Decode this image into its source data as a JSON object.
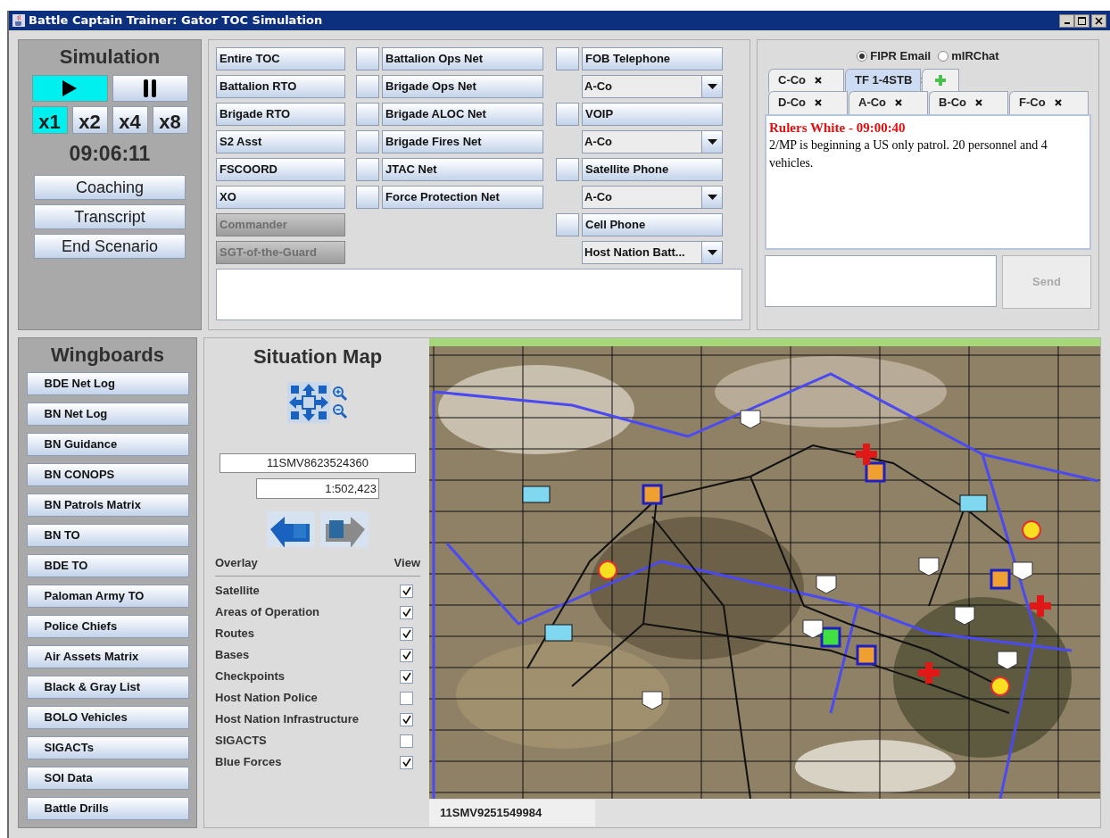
{
  "window": {
    "title": "Battle Captain Trainer: Gator TOC Simulation"
  },
  "simulation": {
    "title": "Simulation",
    "transport": [
      {
        "kind": "play",
        "selected": true
      },
      {
        "kind": "pause",
        "selected": false
      }
    ],
    "speeds": [
      {
        "label": "x1",
        "selected": true
      },
      {
        "label": "x2",
        "selected": false
      },
      {
        "label": "x4",
        "selected": false
      },
      {
        "label": "x8",
        "selected": false
      }
    ],
    "clock": "09:06:11",
    "buttons": [
      "Coaching",
      "Transcript",
      "End Scenario"
    ]
  },
  "comms": {
    "roles": [
      {
        "label": "Entire TOC",
        "disabled": false
      },
      {
        "label": "Battalion RTO",
        "disabled": false
      },
      {
        "label": "Brigade RTO",
        "disabled": false
      },
      {
        "label": "S2 Asst",
        "disabled": false
      },
      {
        "label": "FSCOORD",
        "disabled": false
      },
      {
        "label": "XO",
        "disabled": false
      },
      {
        "label": "Commander",
        "disabled": true
      },
      {
        "label": "SGT-of-the-Guard",
        "disabled": true
      }
    ],
    "nets": [
      "Battalion Ops Net",
      "Brigade Ops Net",
      "Brigade ALOC Net",
      "Brigade Fires Net",
      "JTAC Net",
      "Force Protection Net"
    ],
    "devices": [
      {
        "kind": "button",
        "label": "FOB Telephone"
      },
      {
        "kind": "dropdown",
        "value": "A-Co"
      },
      {
        "kind": "button",
        "label": "VOIP"
      },
      {
        "kind": "dropdown",
        "value": "A-Co"
      },
      {
        "kind": "button",
        "label": "Satellite Phone"
      },
      {
        "kind": "dropdown",
        "value": "A-Co"
      },
      {
        "kind": "button",
        "label": "Cell Phone"
      },
      {
        "kind": "dropdown",
        "value": "Host Nation Batt..."
      }
    ]
  },
  "chat": {
    "modes": [
      {
        "label": "FIPR Email",
        "selected": true
      },
      {
        "label": "mIRChat",
        "selected": false
      }
    ],
    "tab_rows": [
      [
        {
          "kind": "tab",
          "label": "C-Co",
          "selected": false
        },
        {
          "kind": "tab",
          "label": "TF 1-4STB",
          "selected": true
        },
        {
          "kind": "add"
        }
      ],
      [
        {
          "kind": "tab",
          "label": "D-Co",
          "selected": false
        },
        {
          "kind": "tab",
          "label": "A-Co",
          "selected": false
        },
        {
          "kind": "tab",
          "label": "B-Co",
          "selected": false
        },
        {
          "kind": "tab",
          "label": "F-Co",
          "selected": false
        }
      ]
    ],
    "message": {
      "header": "Rulers White - 09:00:40",
      "body": "2/MP is beginning a US only patrol. 20 personnel and 4 vehicles."
    },
    "send_button": {
      "label": "Send",
      "disabled": true
    }
  },
  "wingboards": {
    "title": "Wingboards",
    "items": [
      "BDE Net Log",
      "BN Net Log",
      "BN Guidance",
      "BN CONOPS",
      "BN Patrols Matrix",
      "BN TO",
      "BDE TO",
      "Paloman Army TO",
      "Police Chiefs",
      "Air Assets Matrix",
      "Black & Gray List",
      "BOLO Vehicles",
      "SIGACTs",
      "SOI Data",
      "Battle Drills"
    ]
  },
  "situation_map": {
    "title": "Situation Map",
    "grid_reference": "11SMV8623524360",
    "scale": "1:502,423",
    "overlay_header": "Overlay",
    "view_header": "View",
    "overlays": [
      {
        "label": "Satellite",
        "checked": true
      },
      {
        "label": "Areas of Operation",
        "checked": true
      },
      {
        "label": "Routes",
        "checked": true
      },
      {
        "label": "Bases",
        "checked": true
      },
      {
        "label": "Checkpoints",
        "checked": true
      },
      {
        "label": "Host Nation Police",
        "checked": false
      },
      {
        "label": "Host Nation Infrastructure",
        "checked": true
      },
      {
        "label": "SIGACTS",
        "checked": false
      },
      {
        "label": "Blue Forces",
        "checked": true
      }
    ],
    "cursor_reference": "11SMV9251549984"
  }
}
